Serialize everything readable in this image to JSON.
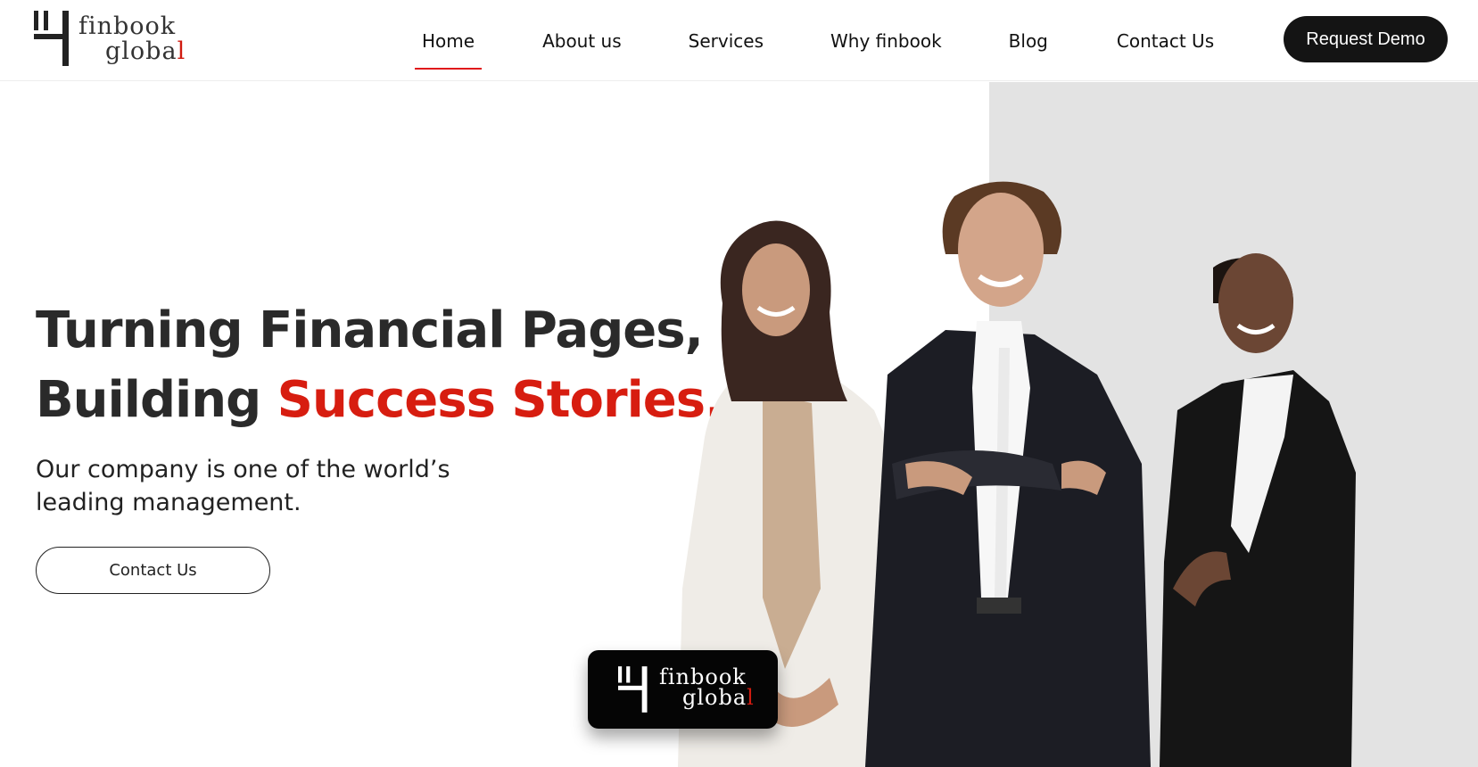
{
  "brand": {
    "line1": "finbook",
    "line2_main": "globa",
    "line2_accent": "l",
    "accent_color": "#d01b10",
    "logo_icon": "finbook-logo-icon"
  },
  "nav": {
    "items": [
      {
        "label": "Home",
        "active": true
      },
      {
        "label": "About us",
        "active": false
      },
      {
        "label": "Services",
        "active": false
      },
      {
        "label": "Why finbook",
        "active": false
      },
      {
        "label": "Blog",
        "active": false
      },
      {
        "label": "Contact Us",
        "active": false
      }
    ],
    "cta_label": "Request Demo"
  },
  "hero": {
    "title_line1": "Turning Financial Pages,",
    "title_line2_prefix": "Building ",
    "title_line2_accent": "Success Stories.",
    "subtitle": "Our company is one of the world’s leading management.",
    "button_label": "Contact Us",
    "accent_color": "#d71d10",
    "image": "business-team-photo"
  },
  "badge": {
    "line1": "finbook",
    "line2_main": "globa",
    "line2_accent": "l"
  }
}
